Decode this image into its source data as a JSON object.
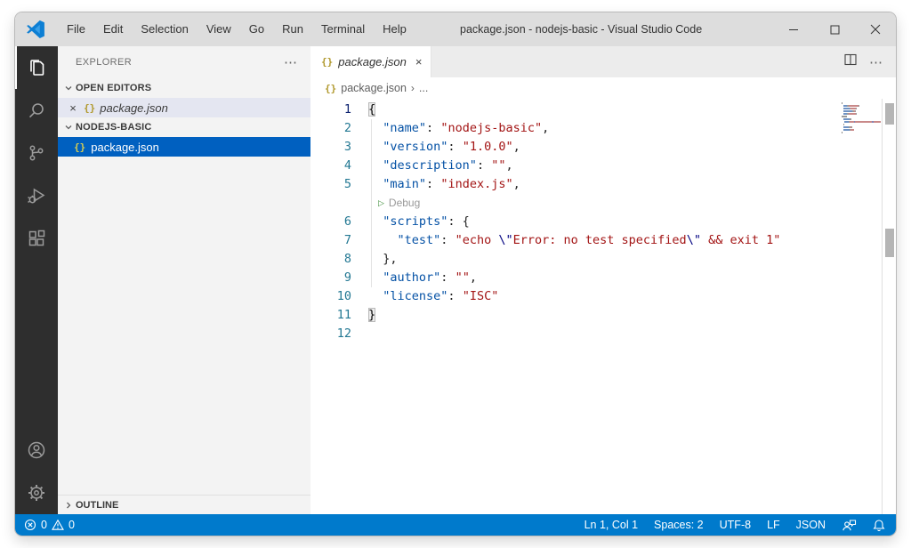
{
  "window": {
    "title": "package.json - nodejs-basic - Visual Studio Code"
  },
  "menu": {
    "items": [
      "File",
      "Edit",
      "Selection",
      "View",
      "Go",
      "Run",
      "Terminal",
      "Help"
    ]
  },
  "activity_bar": {
    "icons": [
      "files-icon",
      "search-icon",
      "source-control-icon",
      "run-debug-icon",
      "extensions-icon",
      "account-icon",
      "settings-gear-icon"
    ]
  },
  "sidebar": {
    "title": "EXPLORER",
    "more": "⋯",
    "open_editors": {
      "label": "OPEN EDITORS",
      "items": [
        {
          "name": "package.json",
          "icon": "{}",
          "close": "×"
        }
      ]
    },
    "folder": {
      "label": "NODEJS-BASIC",
      "items": [
        {
          "name": "package.json",
          "icon": "{}"
        }
      ]
    },
    "outline": {
      "label": "OUTLINE"
    }
  },
  "tab": {
    "icon": "{}",
    "label": "package.json",
    "close": "×"
  },
  "tab_actions": {
    "split_icon": "split-editor",
    "more": "⋯"
  },
  "breadcrumb": {
    "icon": "{}",
    "file": "package.json",
    "separator": "›",
    "more": "..."
  },
  "editor": {
    "active_line": "1",
    "lines": [
      {
        "n": "1",
        "seg": [
          [
            "bm",
            "{"
          ]
        ]
      },
      {
        "n": "2",
        "seg": [
          [
            "pk",
            "  "
          ],
          [
            "key",
            "\"name\""
          ],
          [
            "pk",
            ": "
          ],
          [
            "str",
            "\"nodejs-basic\""
          ],
          [
            "pk",
            ","
          ]
        ]
      },
      {
        "n": "3",
        "seg": [
          [
            "pk",
            "  "
          ],
          [
            "key",
            "\"version\""
          ],
          [
            "pk",
            ": "
          ],
          [
            "str",
            "\"1.0.0\""
          ],
          [
            "pk",
            ","
          ]
        ]
      },
      {
        "n": "4",
        "seg": [
          [
            "pk",
            "  "
          ],
          [
            "key",
            "\"description\""
          ],
          [
            "pk",
            ": "
          ],
          [
            "str",
            "\"\""
          ],
          [
            "pk",
            ","
          ]
        ]
      },
      {
        "n": "5",
        "seg": [
          [
            "pk",
            "  "
          ],
          [
            "key",
            "\"main\""
          ],
          [
            "pk",
            ": "
          ],
          [
            "str",
            "\"index.js\""
          ],
          [
            "pk",
            ","
          ]
        ]
      },
      {
        "lens": true,
        "play": "▷",
        "label": "Debug"
      },
      {
        "n": "6",
        "seg": [
          [
            "pk",
            "  "
          ],
          [
            "key",
            "\"scripts\""
          ],
          [
            "pk",
            ": {"
          ]
        ]
      },
      {
        "n": "7",
        "seg": [
          [
            "pk",
            "    "
          ],
          [
            "key",
            "\"test\""
          ],
          [
            "pk",
            ": "
          ],
          [
            "str",
            "\"echo "
          ],
          [
            "esc",
            "\\\""
          ],
          [
            "str",
            "Error: no test specified"
          ],
          [
            "esc",
            "\\\""
          ],
          [
            "str",
            " && exit 1\""
          ]
        ]
      },
      {
        "n": "8",
        "seg": [
          [
            "pk",
            "  },"
          ]
        ]
      },
      {
        "n": "9",
        "seg": [
          [
            "pk",
            "  "
          ],
          [
            "key",
            "\"author\""
          ],
          [
            "pk",
            ": "
          ],
          [
            "str",
            "\"\""
          ],
          [
            "pk",
            ","
          ]
        ]
      },
      {
        "n": "10",
        "seg": [
          [
            "pk",
            "  "
          ],
          [
            "key",
            "\"license\""
          ],
          [
            "pk",
            ": "
          ],
          [
            "str",
            "\"ISC\""
          ]
        ]
      },
      {
        "n": "11",
        "seg": [
          [
            "bm",
            "}"
          ]
        ]
      },
      {
        "n": "12",
        "seg": []
      }
    ]
  },
  "status_bar": {
    "errors": "0",
    "warnings": "0",
    "line_col": "Ln 1, Col 1",
    "indent": "Spaces: 2",
    "encoding": "UTF-8",
    "eol": "LF",
    "language": "JSON"
  },
  "colors": {
    "accent": "#007ACC",
    "selection_blue": "#0060C0",
    "activity_bar_bg": "#2E2E2E",
    "sidebar_bg": "#F3F3F3",
    "json_key": "#0451A5",
    "json_string": "#A31515",
    "json_escape": "#000080",
    "line_number": "#237893"
  }
}
